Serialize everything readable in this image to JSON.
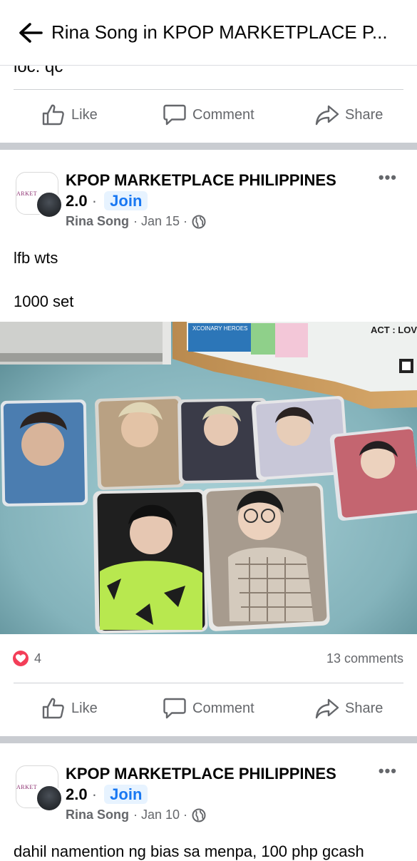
{
  "header": {
    "title": "Rina Song in KPOP MARKETPLACE P..."
  },
  "previous_post": {
    "text_tail": "loc: qc",
    "like_label": "Like",
    "comment_label": "Comment",
    "share_label": "Share"
  },
  "post1": {
    "group_name_line1": "KPOP MARKETPLACE PHILIPPINES",
    "group_name_line2": "2.0",
    "dot": "·",
    "join_label": "Join",
    "author": "Rina Song",
    "date": "· Jan 15 ·",
    "more_label": "•••",
    "text_line1": "lfb wts",
    "text_line2": "1000 set",
    "reaction_count": "4",
    "comments_count": "13 comments",
    "like_label": "Like",
    "comment_label": "Comment",
    "share_label": "Share",
    "photo": {
      "sign_text": "XCOINARY HEROES",
      "ticket_text": "ACT : LOVESIC"
    }
  },
  "post2": {
    "group_name_line1": "KPOP MARKETPLACE PHILIPPINES",
    "group_name_line2": "2.0",
    "dot": "·",
    "join_label": "Join",
    "author": "Rina Song",
    "date": "· Jan 10 ·",
    "more_label": "•••",
    "text_line1": "dahil namention ng bias sa menpa, 100 php gcash"
  },
  "group_avatar_mini_text": "ARKET",
  "colors": {
    "link_blue": "#1877f2",
    "secondary_gray": "#65676b",
    "separator": "#c9ccd1",
    "heart_red": "#f33e58"
  }
}
